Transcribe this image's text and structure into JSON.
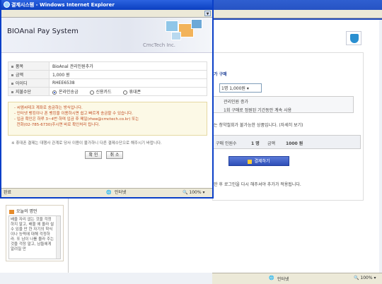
{
  "popup": {
    "window_title": "결제시스템 - Windows Internet Explorer",
    "header_title": "BIOAnal Pay System",
    "company": "CmcTech Inc.",
    "rows": [
      {
        "label": "품목",
        "value": "BioAnal 관리인원추가"
      },
      {
        "label": "금액",
        "value": "1,000 원"
      },
      {
        "label": "아이디",
        "value": "RHEE6538"
      },
      {
        "label": "지불수단",
        "value": ""
      }
    ],
    "pay_options": [
      "온라인송금",
      "신용카드",
      "휴대폰"
    ],
    "selected_option": "온라인송금",
    "notice_lines": [
      "- 씨엠씨테크 계좌로 송금하는 방식입니다.",
      "- 인터넷 뱅킹이나 폰 뱅킹을 이용하시면 쉽고 빠르게 송금할 수 있습니다.",
      "- 입금 확인은 하루 3~4번 하며 입금 후 메일(rhee@cmctech.co.kr) 또는",
      "  전화(02-785-6730)주시면 바로 확인처리 됩니다."
    ],
    "caution": "※ 휴대폰 결제는 대행사 관계로 당사 이용이 불가하니 다른 결제수단으로 해주시기 바랍니다.",
    "confirm_label": "확 인",
    "cancel_label": "취 소",
    "status_left": "완료",
    "status_zone": "인터넷",
    "status_zoom": "100%"
  },
  "background": {
    "section_title": "가 구매",
    "count_select": "1명 1,000원",
    "row1": "관리인원 증가",
    "row2": "1회 구매로 정원된 기간동안 계속 사용",
    "refund_note": "는 청약철회가 불가능한 상품입니다. (자세히 보기)",
    "summary_label": "구매 인원수",
    "summary_count": "1 명",
    "summary_price_label": "금액",
    "summary_price": "1000 원",
    "pay_button": "결제하기",
    "relogin_note": "한 후 로그인을 다시 해주셔야 추가가 적용됩니다.",
    "status_zone": "인터넷",
    "status_zoom": "100%"
  },
  "today": {
    "title": "오늘의 명언",
    "text": "배울 자리 없는 것을 걱정하지 말고, 배울 에 올라 설 수 있을 만 한 자기의 학식이나 능력에 대해 걱정하라. 또 남이 나를 몰라 주는 것을 걱정 말고, 남들에게 알려질 만"
  }
}
